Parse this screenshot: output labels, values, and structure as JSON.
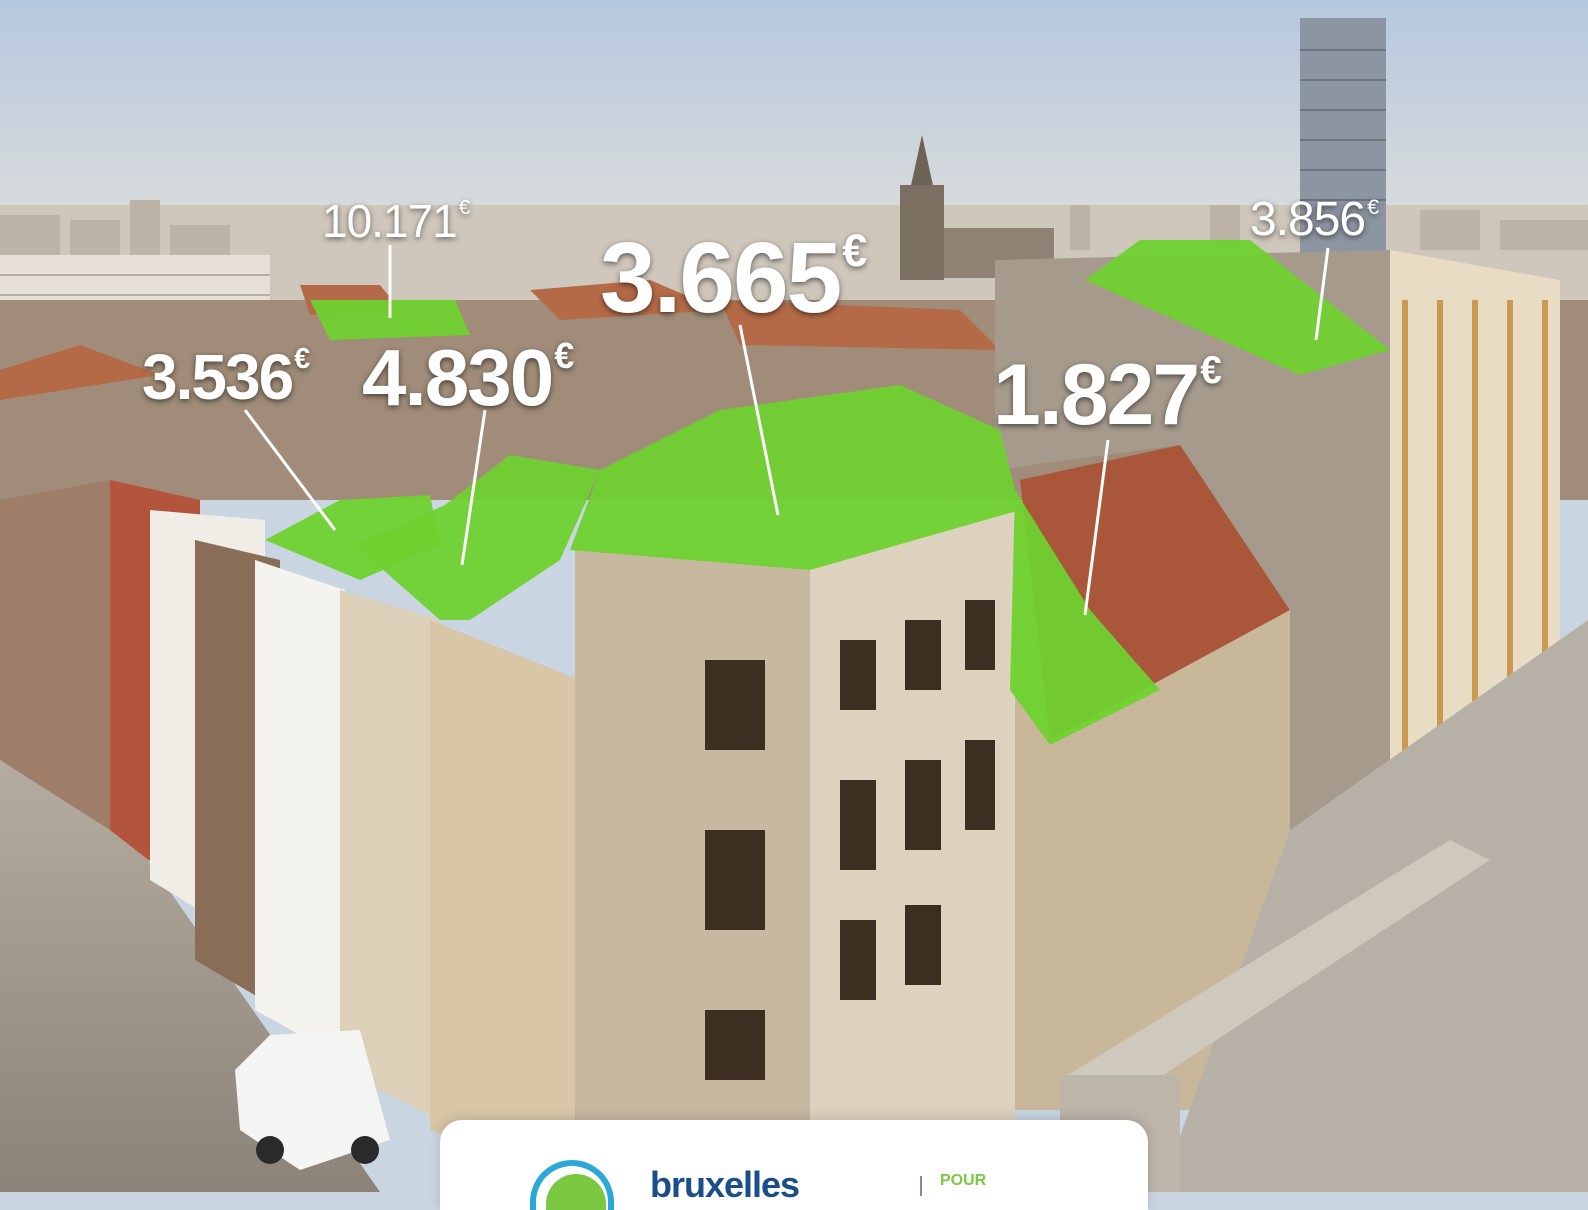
{
  "labels": [
    {
      "value": "10.171",
      "currency": "€"
    },
    {
      "value": "3.665",
      "currency": "€"
    },
    {
      "value": "3.856",
      "currency": "€"
    },
    {
      "value": "3.536",
      "currency": "€"
    },
    {
      "value": "4.830",
      "currency": "€"
    },
    {
      "value": "1.827",
      "currency": "€"
    }
  ],
  "brand": {
    "name": "bruxelles",
    "tagline": "POUR"
  },
  "colors": {
    "roof_green": "#6fd12f",
    "sky_top": "#b9cbe0",
    "logo_blue": "#2aa8d6",
    "logo_green": "#7bc943"
  }
}
